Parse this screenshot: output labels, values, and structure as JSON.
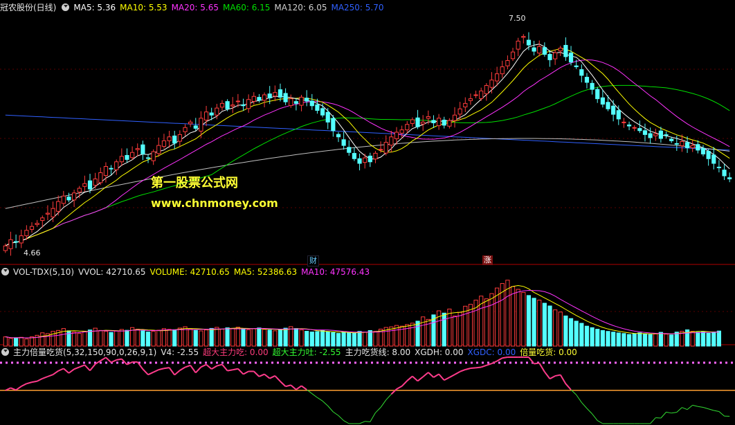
{
  "main_header": {
    "stock_name": "冠农股份(日线)",
    "ma5": "MA5: 5.36",
    "ma10": "MA10: 5.53",
    "ma20": "MA20: 5.65",
    "ma60": "MA60: 6.15",
    "ma120": "MA120: 6.05",
    "ma250": "MA250: 5.70"
  },
  "vol_header": {
    "name": "VOL-TDX(5,10)",
    "vvol": "VVOL: 42710.65",
    "volume": "VOLUME: 42710.65",
    "ma5": "MA5: 52386.63",
    "ma10": "MA10: 47576.43"
  },
  "ind_header": {
    "name": "主力倍量吃货(5,32,150,90,0,26,9,1)",
    "v4": "V4: -2.55",
    "super_eat": "超大主力吃: 0.00",
    "super_spit": "超大主力吐: -2.55",
    "eat_line": "主力吃货线: 8.00",
    "xgdh": "XGDH: 0.00",
    "xgdc": "XGDC: 0.00",
    "double_eat": "倍量吃货: 0.00"
  },
  "watermark": {
    "line1": "第一股票公式网",
    "line2": "www.chnmoney.com"
  },
  "markers": {
    "high_label": "7.50",
    "low_label": "4.66",
    "tag_cai": "财",
    "tag_zhang": "涨"
  },
  "colors": {
    "up": "#ff3c3c",
    "down": "#54ffff",
    "ma5": "#ffffff",
    "ma10": "#ffff00",
    "ma20": "#ff33ff",
    "ma60": "#00e000",
    "ma120": "#c0c0c0",
    "ma250": "#3060ff"
  },
  "chart_data": {
    "type": "candlestick",
    "price_range": [
      4.5,
      7.7
    ],
    "closes": [
      4.72,
      4.8,
      4.77,
      4.85,
      4.92,
      4.97,
      5.01,
      5.08,
      5.14,
      5.2,
      5.29,
      5.36,
      5.31,
      5.4,
      5.46,
      5.52,
      5.45,
      5.58,
      5.66,
      5.74,
      5.71,
      5.8,
      5.87,
      5.83,
      5.92,
      5.97,
      5.9,
      5.85,
      5.93,
      6.01,
      6.07,
      6.12,
      6.04,
      6.15,
      6.24,
      6.31,
      6.23,
      6.36,
      6.44,
      6.4,
      6.49,
      6.55,
      6.48,
      6.53,
      6.58,
      6.52,
      6.6,
      6.64,
      6.59,
      6.66,
      6.62,
      6.69,
      6.63,
      6.57,
      6.61,
      6.55,
      6.63,
      6.58,
      6.52,
      6.46,
      6.4,
      6.31,
      6.2,
      6.12,
      6.01,
      5.92,
      5.84,
      5.78,
      5.85,
      5.8,
      5.91,
      5.96,
      6.05,
      6.12,
      6.18,
      6.21,
      6.28,
      6.34,
      6.25,
      6.31,
      6.38,
      6.3,
      6.36,
      6.27,
      6.33,
      6.4,
      6.48,
      6.55,
      6.61,
      6.66,
      6.71,
      6.78,
      6.85,
      6.93,
      7.02,
      7.1,
      7.21,
      7.35,
      7.41,
      7.3,
      7.22,
      7.28,
      7.18,
      7.11,
      7.2,
      7.26,
      7.15,
      7.08,
      7.02,
      6.91,
      6.82,
      6.73,
      6.61,
      6.54,
      6.48,
      6.41,
      6.35,
      6.31,
      6.26,
      6.24,
      6.2,
      6.15,
      6.11,
      6.16,
      6.1,
      6.14,
      6.07,
      6.03,
      6.06,
      5.98,
      6.01,
      5.95,
      5.9,
      5.84,
      5.78,
      5.73,
      5.62,
      5.58
    ],
    "volumes": [
      7800,
      6500,
      6900,
      7400,
      6000,
      7800,
      9100,
      11200,
      10500,
      12400,
      13200,
      14800,
      12900,
      11800,
      10700,
      12300,
      13600,
      15100,
      13200,
      12400,
      11500,
      12700,
      14000,
      13300,
      15600,
      14200,
      12800,
      11900,
      12500,
      13400,
      14700,
      14100,
      13800,
      15200,
      16300,
      14600,
      13200,
      12800,
      13600,
      14900,
      15800,
      14300,
      15400,
      14700,
      15900,
      14500,
      13800,
      14600,
      15300,
      14100,
      13500,
      12900,
      13700,
      15100,
      16400,
      14800,
      13600,
      12500,
      11900,
      12200,
      13100,
      12000,
      11400,
      10700,
      11900,
      11300,
      10800,
      12400,
      11700,
      13100,
      12400,
      14300,
      15700,
      16200,
      17400,
      16800,
      18100,
      19300,
      21000,
      24600,
      22500,
      26300,
      29700,
      27800,
      31200,
      25300,
      28400,
      33600,
      35200,
      38700,
      42100,
      39800,
      44200,
      48900,
      52700,
      55500,
      50100,
      47800,
      45200,
      42600,
      40300,
      38700,
      36100,
      33800,
      30500,
      28700,
      25400,
      23200,
      21000,
      19200,
      16800,
      15500,
      14200,
      13100,
      12400,
      11800,
      11100,
      10600,
      9800,
      10400,
      11200,
      10500,
      9700,
      10300,
      11600,
      10100,
      9400,
      11800,
      12500,
      13700,
      12400,
      11600,
      12200,
      10800,
      11900,
      12700
    ]
  }
}
